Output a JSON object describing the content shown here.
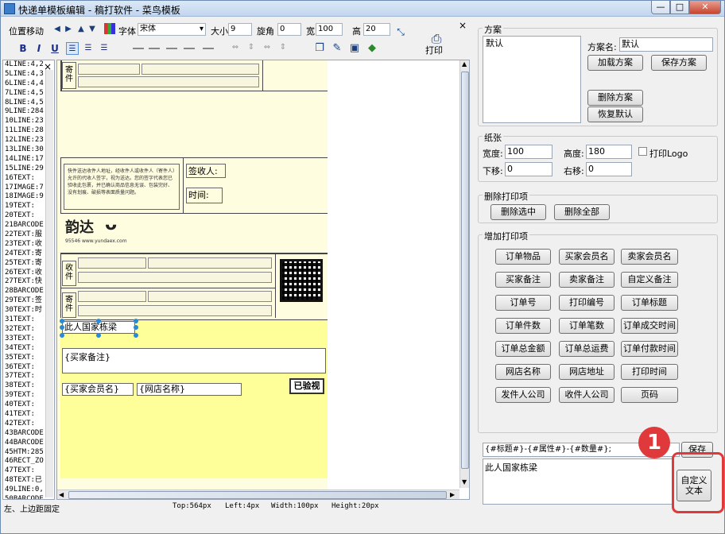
{
  "window": {
    "title": "快递单模板编辑 - 稿打软件 - 菜鸟模板",
    "min_label": "—",
    "max_label": "□",
    "close_label": "✕"
  },
  "toolbar": {
    "position_label": "位置移动",
    "font_label": "字体",
    "font_value": "宋体",
    "size_label": "大小",
    "size_value": "9",
    "rotate_label": "旋角",
    "rotate_value": "0",
    "width_label": "宽",
    "width_value": "100",
    "height_label": "高",
    "height_value": "20",
    "print_label": "打印",
    "bold": "B",
    "italic": "I",
    "underline": "U"
  },
  "list": {
    "close": "×",
    "items": [
      "4LINE:4,2",
      "5LINE:4,3",
      "6LINE:4,4",
      "7LINE:4,5",
      "8LINE:4,5",
      "9LINE:284",
      "10LINE:23",
      "11LINE:28",
      "12LINE:23",
      "13LINE:30",
      "14LINE:17",
      "15LINE:29",
      "16TEXT:",
      "17IMAGE:7",
      "18IMAGE:9",
      "19TEXT:",
      "20TEXT:",
      "21BARCODE",
      "22TEXT:服",
      "23TEXT:收",
      "24TEXT:寄",
      "25TEXT:寄",
      "26TEXT:收",
      "27TEXT:快",
      "28BARCODE",
      "29TEXT:签",
      "30TEXT:时",
      "31TEXT:",
      "32TEXT:",
      "33TEXT:",
      "34TEXT:",
      "35TEXT:",
      "36TEXT:",
      "37TEXT:",
      "38TEXT:",
      "39TEXT:",
      "40TEXT:",
      "41TEXT:",
      "42TEXT:",
      "43BARCODE",
      "44BARCODE",
      "45HTM:285",
      "46RECT_ZO",
      "47TEXT:",
      "48TEXT:已",
      "49LINE:0,",
      "50BARCODE",
      "51TEXT:{",
      "52TEXT:{",
      "53TEXT:{"
    ]
  },
  "canvas": {
    "sender_label": "寄件",
    "receiver_label": "收件",
    "sign_label": "签收人:",
    "time_label": "时间:",
    "notice_text": "快件送达收件人地址，经收件人或收件人（寄件人）允许的代收人签字，视为送达。您的签字代表您已验收此包裹，并已确认商品信息无误、包装完好、没有划痕、破损等表面质量问题。",
    "logo_text": "韵达",
    "logo_sub": "95546  www.yundaex.com",
    "selected_text": "此人国家栋梁",
    "buyer_note": "{买家备注}",
    "buyer_member": "{买家会员名}",
    "shop_name": "{网店名称}",
    "checked": "已验视"
  },
  "status": {
    "hint": "左、上边距固定",
    "top": "Top:564px",
    "left": "Left:4px",
    "width": "Width:100px",
    "height": "Height:20px"
  },
  "scheme": {
    "group": "方案",
    "list_item": "默认",
    "name_label": "方案名:",
    "name_value": "默认",
    "load": "加载方案",
    "save": "保存方案",
    "delete": "删除方案",
    "restore": "恢复默认"
  },
  "paper": {
    "group": "纸张",
    "width_label": "宽度:",
    "width_value": "100",
    "height_label": "高度:",
    "height_value": "180",
    "print_logo": "打印Logo",
    "down_label": "下移:",
    "down_value": "0",
    "right_label": "右移:",
    "right_value": "0"
  },
  "delete_items": {
    "group": "删除打印项",
    "selected": "删除选中",
    "all": "删除全部"
  },
  "add_items": {
    "group": "增加打印项",
    "buttons": [
      "订单物品",
      "买家会员名",
      "卖家会员名",
      "买家备注",
      "卖家备注",
      "自定义备注",
      "订单号",
      "打印编号",
      "订单标题",
      "订单件数",
      "订单笔数",
      "订单成交时间",
      "订单总金额",
      "订单总运费",
      "订单付款时间",
      "网店名称",
      "网店地址",
      "打印时间",
      "发件人公司",
      "收件人公司",
      "页码"
    ]
  },
  "custom": {
    "template_value": "{#标题#}-{#属性#}-{#数量#};",
    "save": "保存",
    "text_value": "此人国家栋梁",
    "custom_button": "自定义文本",
    "badge": "1"
  }
}
